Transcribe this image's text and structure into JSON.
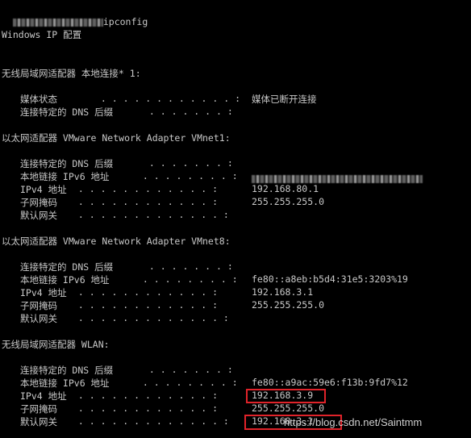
{
  "prompt": {
    "blurred_path": true,
    "command": "ipconfig"
  },
  "header": "Windows IP 配置",
  "sections": [
    {
      "title": "无线局域网适配器 本地连接* 1:",
      "rows": [
        {
          "label": "媒体状态",
          "dots": " . . . . . . . . . . . . :",
          "value": "媒体已断开连接"
        },
        {
          "label": "连接特定的 DNS 后缀",
          "dots": " . . . . . . . :",
          "value": ""
        }
      ]
    },
    {
      "title": "以太网适配器 VMware Network Adapter VMnet1:",
      "rows": [
        {
          "label": "连接特定的 DNS 后缀",
          "dots": " . . . . . . . :",
          "value": ""
        },
        {
          "label": "本地链接 IPv6 地址",
          "dots": " . . . . . . . . :",
          "value": "",
          "blurred": true
        },
        {
          "label": "IPv4 地址",
          "dots": " . . . . . . . . . . . . :",
          "value": "192.168.80.1"
        },
        {
          "label": "子网掩码",
          "dots": " . . . . . . . . . . . . :",
          "value": "255.255.255.0"
        },
        {
          "label": "默认网关",
          "dots": " . . . . . . . . . . . . . :",
          "value": ""
        }
      ]
    },
    {
      "title": "以太网适配器 VMware Network Adapter VMnet8:",
      "rows": [
        {
          "label": "连接特定的 DNS 后缀",
          "dots": " . . . . . . . :",
          "value": ""
        },
        {
          "label": "本地链接 IPv6 地址",
          "dots": " . . . . . . . . :",
          "value": "fe80::a8eb:b5d4:31e5:3203%19"
        },
        {
          "label": "IPv4 地址",
          "dots": " . . . . . . . . . . . . :",
          "value": "192.168.3.1"
        },
        {
          "label": "子网掩码",
          "dots": " . . . . . . . . . . . . :",
          "value": "255.255.255.0"
        },
        {
          "label": "默认网关",
          "dots": " . . . . . . . . . . . . . :",
          "value": ""
        }
      ]
    },
    {
      "title": "无线局域网适配器 WLAN:",
      "rows": [
        {
          "label": "连接特定的 DNS 后缀",
          "dots": " . . . . . . . :",
          "value": ""
        },
        {
          "label": "本地链接 IPv6 地址",
          "dots": " . . . . . . . . :",
          "value": "fe80::a9ac:59e6:f13b:9fd7%12"
        },
        {
          "label": "IPv4 地址",
          "dots": " . . . . . . . . . . . . :",
          "value": "192.168.3.9",
          "highlight": true
        },
        {
          "label": "子网掩码",
          "dots": " . . . . . . . . . . . . :",
          "value": "255.255.255.0"
        },
        {
          "label": "默认网关",
          "dots": " . . . . . . . . . . . . . :",
          "value": "192.168.3.1",
          "highlight": true
        }
      ]
    }
  ],
  "watermark": "https://blog.csdn.net/Saintmm",
  "colors": {
    "background": "#000000",
    "text": "#c8c8c8",
    "highlight_box": "#e0232a"
  }
}
